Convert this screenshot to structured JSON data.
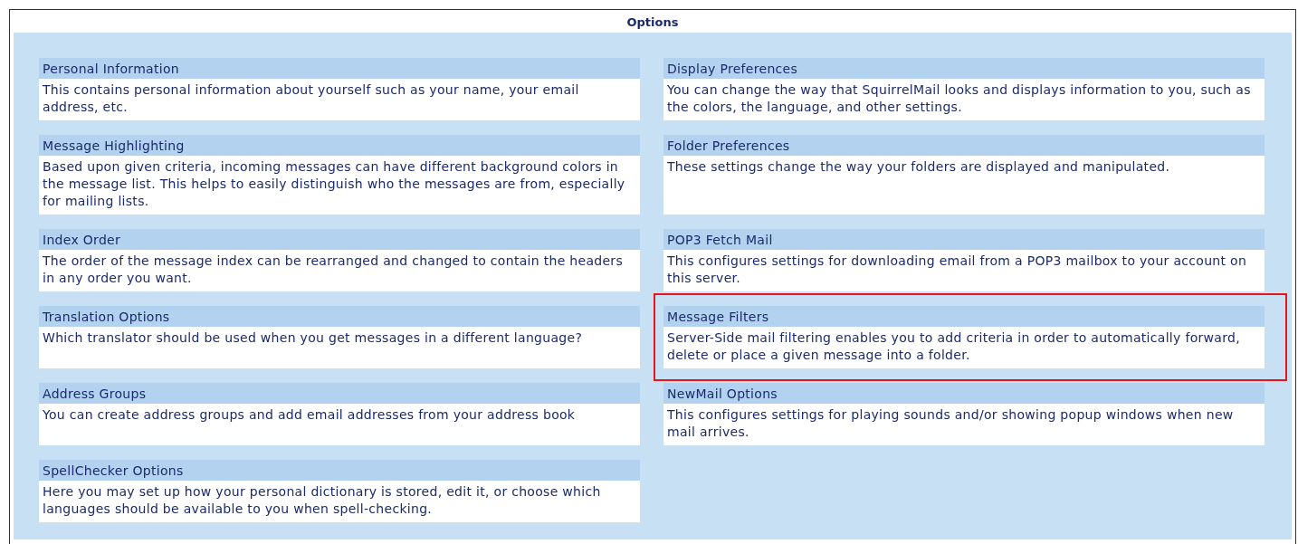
{
  "title": "Options",
  "items": [
    {
      "title": "Personal Information",
      "description": "This contains personal information about yourself such as your name, your email address, etc.",
      "highlighted": false
    },
    {
      "title": "Display Preferences",
      "description": "You can change the way that SquirrelMail looks and displays information to you, such as the colors, the language, and other settings.",
      "highlighted": false
    },
    {
      "title": "Message Highlighting",
      "description": "Based upon given criteria, incoming messages can have different background colors in the message list. This helps to easily distinguish who the messages are from, especially for mailing lists.",
      "highlighted": false
    },
    {
      "title": "Folder Preferences",
      "description": "These settings change the way your folders are displayed and manipulated.",
      "highlighted": false
    },
    {
      "title": "Index Order",
      "description": "The order of the message index can be rearranged and changed to contain the headers in any order you want.",
      "highlighted": false
    },
    {
      "title": "POP3 Fetch Mail",
      "description": "This configures settings for downloading email from a POP3 mailbox to your account on this server.",
      "highlighted": false
    },
    {
      "title": "Translation Options",
      "description": "Which translator should be used when you get messages in a different language?",
      "highlighted": false
    },
    {
      "title": "Message Filters",
      "description": "Server-Side mail filtering enables you to add criteria in order to automatically forward, delete or place a given message into a folder.",
      "highlighted": true
    },
    {
      "title": "Address Groups",
      "description": "You can create address groups and add email addresses from your address book",
      "highlighted": false
    },
    {
      "title": "NewMail Options",
      "description": "This configures settings for playing sounds and/or showing popup windows when new mail arrives.",
      "highlighted": false
    },
    {
      "title": "SpellChecker Options",
      "description": "Here you may set up how your personal dictionary is stored, edit it, or choose which languages should be available to you when spell-checking.",
      "highlighted": false
    }
  ]
}
